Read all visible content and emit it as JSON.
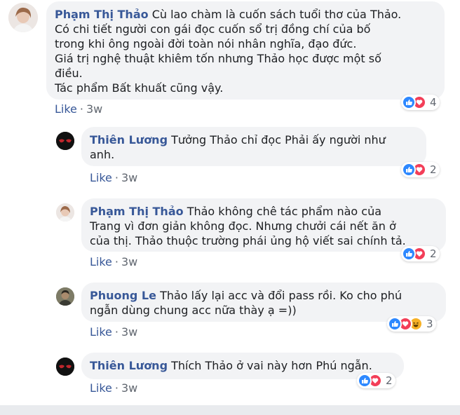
{
  "comments": [
    {
      "author": "Phạm Thị Thảo",
      "text": "Cù lao chàm là cuốn sách tuổi thơ của Thảo.",
      "lines": [
        "Có chi tiết người con gái đọc cuốn sổ trị đồng chí của bố",
        "trong khi ông ngoài đời toàn nói nhân nghĩa, đạo đức.",
        "Giá trị nghệ thuật khiêm tốn nhưng Thảo học được một số",
        "điều.",
        "Tác phẩm Bất khuất cũng vậy."
      ],
      "action_like": "Like",
      "time": "3w",
      "reaction_count": "4",
      "reactions": [
        "like-icon",
        "love-icon"
      ]
    },
    {
      "author": "Thiên Lương",
      "text": "Tưởng Thảo chỉ đọc Phải ấy người như",
      "lines": [
        "anh."
      ],
      "action_like": "Like",
      "time": "3w",
      "reaction_count": "2",
      "reactions": [
        "like-icon",
        "love-icon"
      ]
    },
    {
      "author": "Phạm Thị Thảo",
      "text": "Thảo không chê tác phẩm nào của",
      "lines": [
        "Trang vì đơn giản không đọc. Nhưng chưởi cái nết ăn ở",
        "của thị. Thảo thuộc trường phái ủng hộ viết sai chính tả."
      ],
      "action_like": "Like",
      "time": "3w",
      "reaction_count": "2",
      "reactions": [
        "like-icon",
        "love-icon"
      ]
    },
    {
      "author": "Phuong Le",
      "text": "Thảo lấy lại acc và đổi pass rồi. Ko cho phú",
      "lines": [
        "ngẫn dùng chung acc nữa thày ạ =))"
      ],
      "action_like": "Like",
      "time": "3w",
      "reaction_count": "3",
      "reactions": [
        "like-icon",
        "love-icon",
        "haha-icon"
      ]
    },
    {
      "author": "Thiên Lương",
      "text": "Thích Thảo ở vai này hơn Phú ngẫn.",
      "lines": [],
      "action_like": "Like",
      "time": "3w",
      "reaction_count": "2",
      "reactions": [
        "like-icon",
        "love-icon"
      ]
    }
  ],
  "separator": "·",
  "colors": {
    "author": "#385898",
    "bubble": "#f2f3f5",
    "like": "#2d88ff",
    "love": "#f33e58",
    "haha": "#f7b125"
  }
}
